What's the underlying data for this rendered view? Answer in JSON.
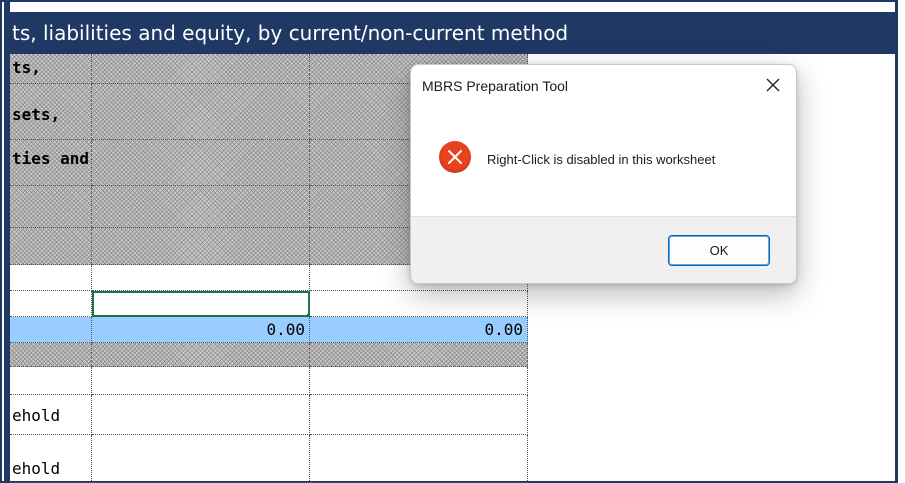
{
  "sheet": {
    "title": "ts, liabilities and equity, by current/non-current method",
    "rows": [
      {
        "label": "ts,",
        "bold": true,
        "hatched": true
      },
      {
        "label": "sets,",
        "bold": true,
        "hatched": true
      },
      {
        "label": "ties and",
        "bold": true,
        "hatched": true
      },
      {
        "label": "",
        "hatched": true
      },
      {
        "label": "",
        "hatched": true
      },
      {
        "label": ""
      },
      {
        "label": ""
      },
      {
        "label": "",
        "c2": "0.00",
        "c3": "0.00",
        "highlighted": true
      },
      {
        "label": "",
        "hatched": true
      },
      {
        "label": ""
      },
      {
        "label": "ehold"
      },
      {
        "label": "ehold"
      }
    ]
  },
  "dialog": {
    "title": "MBRS Preparation Tool",
    "close_icon": "close-icon",
    "message": "Right-Click is disabled in this worksheet",
    "icon": "error-icon",
    "ok_label": "OK"
  },
  "colors": {
    "title_bar": "#1f3864",
    "highlight_row": "#99ccff",
    "selected_cell_border": "#217346",
    "error_icon": "#e8421f",
    "ok_button_border": "#0067c0"
  }
}
